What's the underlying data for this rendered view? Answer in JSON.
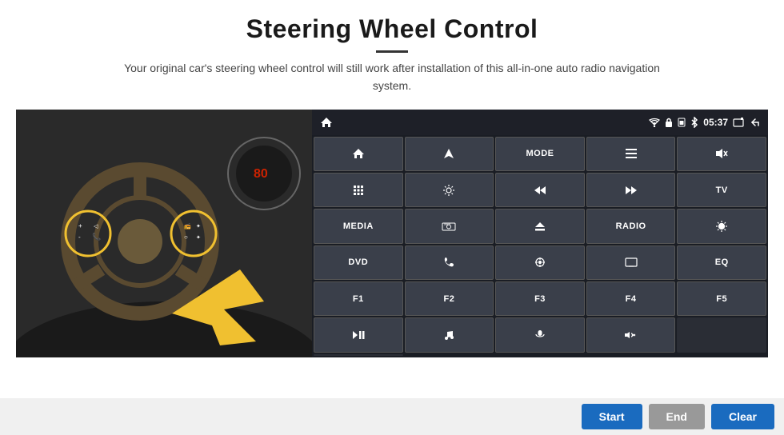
{
  "header": {
    "title": "Steering Wheel Control",
    "subtitle": "Your original car's steering wheel control will still work after installation of this all-in-one auto radio navigation system."
  },
  "status_bar": {
    "time": "05:37",
    "icons": [
      "wifi",
      "lock",
      "sim",
      "bluetooth",
      "screenshot",
      "back"
    ]
  },
  "grid_buttons": [
    {
      "label": "⌂",
      "row": 1,
      "col": 1
    },
    {
      "label": "✈",
      "row": 1,
      "col": 2
    },
    {
      "label": "MODE",
      "row": 1,
      "col": 3
    },
    {
      "label": "≡",
      "row": 1,
      "col": 4
    },
    {
      "label": "🔇",
      "row": 1,
      "col": 5
    },
    {
      "label": "⠿",
      "row": 1,
      "col": 6
    },
    {
      "label": "⚙",
      "row": 2,
      "col": 1
    },
    {
      "label": "⏮",
      "row": 2,
      "col": 2
    },
    {
      "label": "⏭",
      "row": 2,
      "col": 3
    },
    {
      "label": "TV",
      "row": 2,
      "col": 4
    },
    {
      "label": "MEDIA",
      "row": 2,
      "col": 5
    },
    {
      "label": "360°",
      "row": 3,
      "col": 1
    },
    {
      "label": "▲",
      "row": 3,
      "col": 2
    },
    {
      "label": "RADIO",
      "row": 3,
      "col": 3
    },
    {
      "label": "☀",
      "row": 3,
      "col": 4
    },
    {
      "label": "DVD",
      "row": 3,
      "col": 5
    },
    {
      "label": "📞",
      "row": 4,
      "col": 1
    },
    {
      "label": "⊕",
      "row": 4,
      "col": 2
    },
    {
      "label": "⊡",
      "row": 4,
      "col": 3
    },
    {
      "label": "EQ",
      "row": 4,
      "col": 4
    },
    {
      "label": "F1",
      "row": 4,
      "col": 5
    },
    {
      "label": "F2",
      "row": 5,
      "col": 1
    },
    {
      "label": "F3",
      "row": 5,
      "col": 2
    },
    {
      "label": "F4",
      "row": 5,
      "col": 3
    },
    {
      "label": "F5",
      "row": 5,
      "col": 4
    },
    {
      "label": "▶⏸",
      "row": 5,
      "col": 5
    },
    {
      "label": "♪",
      "row": 6,
      "col": 1
    },
    {
      "label": "🎤",
      "row": 6,
      "col": 2
    },
    {
      "label": "🔈",
      "row": 6,
      "col": 3
    }
  ],
  "bottom_buttons": {
    "start_label": "Start",
    "end_label": "End",
    "clear_label": "Clear"
  }
}
